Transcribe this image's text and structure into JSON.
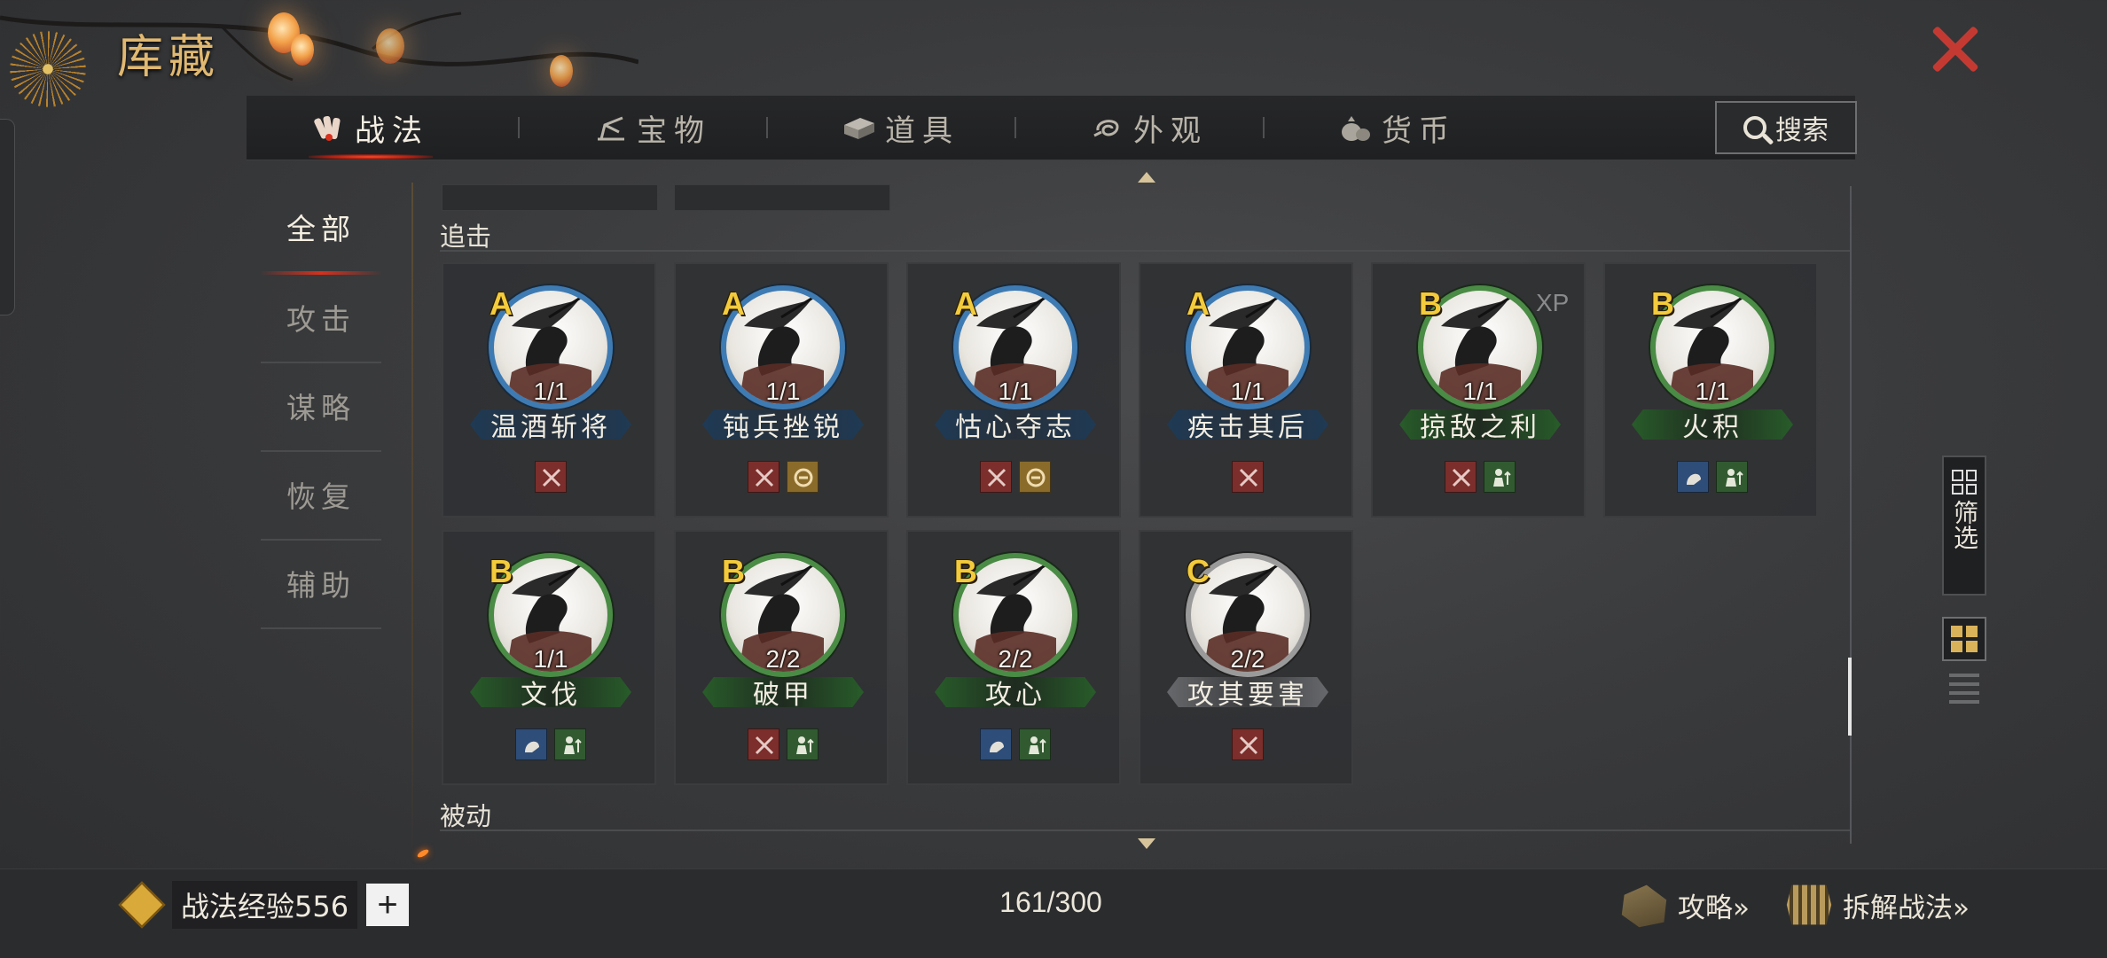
{
  "title": "库藏",
  "tabs": [
    {
      "label": "战法",
      "icon": "scroll-bundle-icon",
      "active": true
    },
    {
      "label": "宝物",
      "icon": "treasure-icon",
      "active": false
    },
    {
      "label": "道具",
      "icon": "item-box-icon",
      "active": false
    },
    {
      "label": "外观",
      "icon": "appearance-swirl-icon",
      "active": false
    },
    {
      "label": "货币",
      "icon": "money-bag-icon",
      "active": false
    }
  ],
  "search": {
    "label": "搜索"
  },
  "categories": [
    {
      "label": "全部",
      "active": true
    },
    {
      "label": "攻击"
    },
    {
      "label": "谋略"
    },
    {
      "label": "恢复"
    },
    {
      "label": "辅助"
    }
  ],
  "sections": {
    "pursuit": "追击",
    "passive": "被动"
  },
  "cards": [
    {
      "grade": "A",
      "name": "温酒斩将",
      "count": "1/1",
      "quality": "blue",
      "tags": [
        "attack"
      ]
    },
    {
      "grade": "A",
      "name": "钝兵挫锐",
      "count": "1/1",
      "quality": "blue",
      "tags": [
        "attack",
        "control"
      ]
    },
    {
      "grade": "A",
      "name": "怙心夺志",
      "count": "1/1",
      "quality": "blue",
      "tags": [
        "attack",
        "control"
      ]
    },
    {
      "grade": "A",
      "name": "疾击其后",
      "count": "1/1",
      "quality": "blue",
      "tags": [
        "attack"
      ]
    },
    {
      "grade": "B",
      "name": "掠敌之利",
      "count": "1/1",
      "quality": "green",
      "tags": [
        "attack",
        "support"
      ],
      "xp": "XP"
    },
    {
      "grade": "B",
      "name": "火积",
      "count": "1/1",
      "quality": "green",
      "tags": [
        "strategy",
        "support"
      ]
    },
    {
      "grade": "B",
      "name": "文伐",
      "count": "1/1",
      "quality": "green",
      "tags": [
        "strategy",
        "support"
      ]
    },
    {
      "grade": "B",
      "name": "破甲",
      "count": "2/2",
      "quality": "green",
      "tags": [
        "attack",
        "support"
      ]
    },
    {
      "grade": "B",
      "name": "攻心",
      "count": "2/2",
      "quality": "green",
      "tags": [
        "strategy",
        "support"
      ]
    },
    {
      "grade": "C",
      "name": "攻其要害",
      "count": "2/2",
      "quality": "gray",
      "tags": [
        "attack"
      ]
    }
  ],
  "filter": {
    "label": "筛选"
  },
  "footer": {
    "exp_label": "战法经验556",
    "plus": "+",
    "capacity": "161/300",
    "guide": "攻略»",
    "dismantle": "拆解战法»"
  },
  "colors": {
    "accent_red": "#c43a32",
    "gold": "#e0b871",
    "grade_gold": "#f3cb3c",
    "blue_quality": "#3f7bb3",
    "green_quality": "#4a8b45"
  }
}
